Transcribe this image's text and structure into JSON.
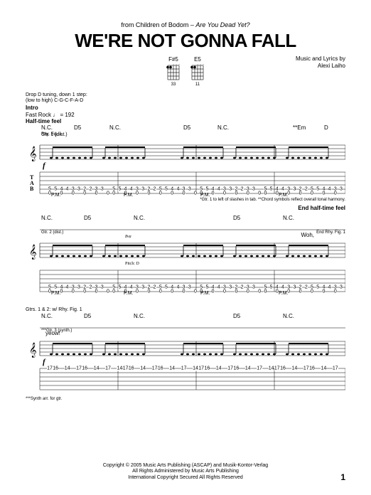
{
  "header": {
    "source_prefix": "from Children of Bodom – ",
    "album": "Are You Dead Yet?",
    "title": "WE'RE NOT GONNA FALL",
    "credits_line1": "Music and Lyrics by",
    "credits_line2": "Alexi Laiho"
  },
  "chord_diagrams": [
    {
      "name": "F#5",
      "frets": "33"
    },
    {
      "name": "E5",
      "frets": "11"
    }
  ],
  "tuning": {
    "line1": "Drop D tuning, down 1 step:",
    "line2": "(low to high) C-G-C-F-A-D"
  },
  "section": {
    "intro": "Intro",
    "tempo": "Fast Rock ♩ = 192",
    "feel": "Half-time feel"
  },
  "systems": [
    {
      "gtr_label": "Gtr. 1 (dist.)",
      "rhy_fig": "Rhy. Fig. 1",
      "chords": [
        "N.C.",
        "D5",
        "N.C.",
        "",
        "D5",
        "N.C.",
        "",
        "**Em",
        "D"
      ],
      "dynamic": "f",
      "pm_segments": [
        "P.M.",
        "P.M.",
        "P.M.",
        "P.M.",
        "P.M."
      ],
      "tab_B": "",
      "tab_values_line5": [
        "5",
        "5",
        "4",
        "4",
        "3",
        "3",
        "2",
        "2",
        "3",
        "3",
        "",
        "5",
        "5",
        "4",
        "4",
        "3",
        "3",
        "2",
        "2",
        "5",
        "5",
        "4",
        "4",
        "3",
        "3",
        "",
        "5",
        "5",
        "4",
        "4",
        "3",
        "3",
        "2",
        "2",
        "3",
        "3",
        "",
        "5",
        "5",
        "4",
        "4",
        "3",
        "3",
        "2",
        "2",
        "5",
        "5",
        "4",
        "4",
        "3",
        "3"
      ],
      "tab_values_line6": [
        "0",
        "",
        "0",
        "",
        "0",
        "",
        "0",
        "",
        "0",
        "",
        "0",
        "0",
        "",
        "0",
        "",
        "0",
        "",
        "0",
        "",
        "0",
        "",
        "0",
        "",
        "0",
        "",
        "0",
        "0",
        "",
        "0",
        "",
        "0",
        "",
        "0",
        "",
        "0",
        "",
        "0",
        "0",
        "",
        "0",
        "",
        "0",
        "",
        "0",
        "",
        "0",
        "",
        "0",
        "",
        "0",
        ""
      ],
      "footnote": "*Gtr. 1 to left of slashes in tab.    **Chord symbols reflect overall tonal harmony."
    },
    {
      "chords": [
        "N.C.",
        "D5",
        "N.C.",
        "",
        "D5",
        "N.C."
      ],
      "end_label": "End half-time feel",
      "lyric": "Woh,",
      "gtr_label": "Gtr. 2 (dist.)",
      "rhy_fig_end": "End Rhy. Fig. 1",
      "pm_segments": [
        "P.M.",
        "P.M.",
        "P.M.",
        "P.M.",
        "P.M."
      ],
      "note_marker": "8va",
      "tab_values_line5": [
        "5",
        "5",
        "4",
        "4",
        "3",
        "3",
        "2",
        "2",
        "3",
        "3",
        "",
        "5",
        "5",
        "4",
        "4",
        "3",
        "3",
        "2",
        "2",
        "5",
        "5",
        "4",
        "4",
        "3",
        "3",
        "",
        "5",
        "5",
        "4",
        "4",
        "3",
        "3",
        "2",
        "2",
        "3",
        "3",
        "",
        "5",
        "5",
        "4",
        "4",
        "3",
        "3",
        "2",
        "2",
        "5",
        "5",
        "4",
        "4",
        "3",
        "3"
      ],
      "tab_values_line6": [
        "0",
        "",
        "0",
        "",
        "0",
        "",
        "0",
        "",
        "0",
        "",
        "0",
        "0",
        "",
        "0",
        "",
        "0",
        "",
        "0",
        "",
        "0",
        "",
        "0",
        "",
        "0",
        "",
        "0",
        "0",
        "",
        "0",
        "",
        "0",
        "",
        "0",
        "",
        "0",
        "",
        "0",
        "0",
        "",
        "0",
        "",
        "0",
        "",
        "0",
        "",
        "0",
        "",
        "0",
        "",
        "0",
        ""
      ],
      "harmony_note": "Pitch: D"
    },
    {
      "rhy_label": "Gtrs. 1 & 2: w/ Rhy. Fig. 1",
      "chords": [
        "N.C.",
        "D5",
        "N.C.",
        "",
        "D5",
        "N.C."
      ],
      "lyric": "yeow!",
      "gtr_label": "***Gtr. 3 (synth.)",
      "dynamic": "f",
      "tab_values_line1": [
        "17",
        "16",
        "",
        "14",
        "",
        "17",
        "16",
        "",
        "14",
        "",
        "17",
        "",
        "14",
        "17",
        "16",
        "",
        "14",
        "",
        "17",
        "16",
        "",
        "14",
        "",
        "17",
        "",
        "14",
        "17",
        "16",
        "",
        "14",
        "",
        "17",
        "16",
        "",
        "14",
        "",
        "17",
        "",
        "14",
        "17",
        "16",
        "",
        "14",
        "",
        "17",
        "16",
        "",
        "14",
        "",
        "17",
        ""
      ],
      "syn_footnote": "***Synth arr. for gtr."
    }
  ],
  "copyright": {
    "line1": "Copyright © 2005 Music Arts Publishing (ASCAP) and Musik-Kontor-Verlag",
    "line2": "All Rights Administered by Music Arts Publishing",
    "line3": "International Copyright Secured   All Rights Reserved"
  },
  "page_number": "1",
  "chart_data": {
    "type": "table",
    "title": "Guitar tablature — We're Not Gonna Fall (Intro)",
    "tempo_bpm": 192,
    "tuning": "Drop D down 1 step (C-G-C-F-A-D)",
    "chord_progression_per_system": [
      "N.C.",
      "D5",
      "N.C.",
      "D5",
      "N.C.",
      "Em",
      "D"
    ],
    "system1_tab_string5_pairs": [
      [
        5,
        5
      ],
      [
        4,
        4
      ],
      [
        3,
        3
      ],
      [
        2,
        2
      ],
      [
        3,
        3
      ],
      [
        5,
        5
      ],
      [
        4,
        4
      ],
      [
        3,
        3
      ],
      [
        2,
        2
      ],
      [
        5,
        5
      ],
      [
        4,
        4
      ],
      [
        3,
        3
      ]
    ],
    "system1_tab_string6_pedal": 0,
    "system3_lead_string1_pattern": [
      17,
      16,
      14,
      17,
      16,
      14,
      17,
      14
    ]
  }
}
